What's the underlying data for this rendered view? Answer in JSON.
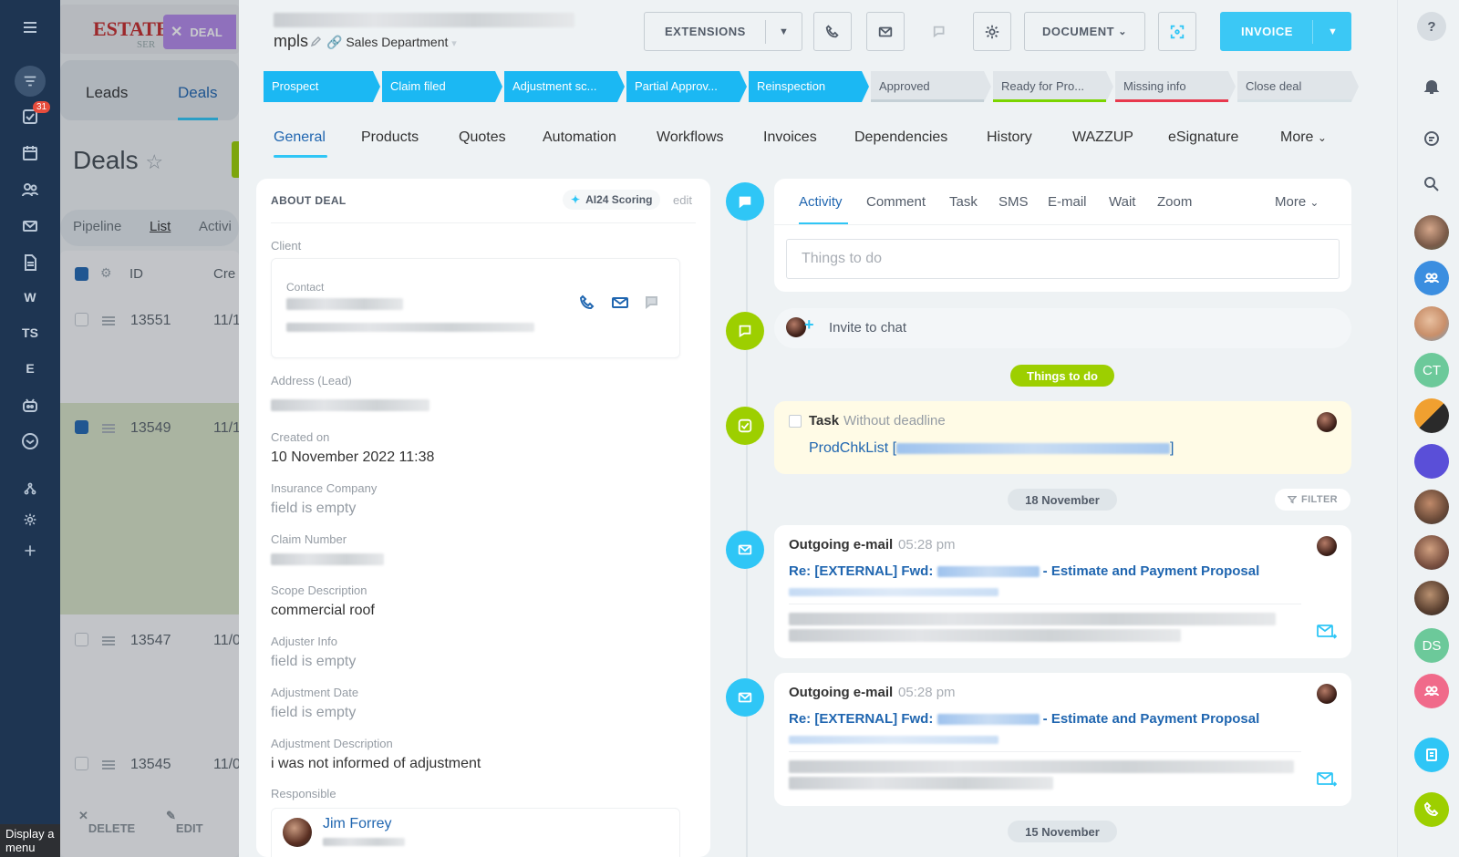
{
  "left_sidebar": {
    "badge": "31",
    "letters": [
      "W",
      "TS",
      "E"
    ],
    "tooltip": "Display a menu"
  },
  "background_list": {
    "logo_text": "ESTATE",
    "logo_sub": "SER",
    "deal_tag": "DEAL",
    "tabs": [
      "Leads",
      "Deals"
    ],
    "title": "Deals",
    "views": [
      "Pipeline",
      "List",
      "Activi"
    ],
    "id_header": "ID",
    "created_header": "Cre",
    "rows": [
      {
        "id": "13551",
        "date": "11/1"
      },
      {
        "id": "13549",
        "date": "11/1"
      },
      {
        "id": "13547",
        "date": "11/0"
      },
      {
        "id": "13545",
        "date": "11/0"
      }
    ],
    "actions": [
      "DELETE",
      "EDIT"
    ]
  },
  "header": {
    "title": "mpls",
    "department": "Sales Department",
    "buttons": {
      "extensions": "EXTENSIONS",
      "document": "DOCUMENT",
      "invoice": "INVOICE"
    }
  },
  "stages": [
    {
      "label": "Prospect",
      "active": true
    },
    {
      "label": "Claim filed",
      "active": true
    },
    {
      "label": "Adjustment sc...",
      "active": true
    },
    {
      "label": "Partial Approv...",
      "active": true
    },
    {
      "label": "Reinspection",
      "active": true
    },
    {
      "label": "Approved",
      "active": false,
      "color": "#c5d0d6"
    },
    {
      "label": "Ready for Pro...",
      "active": false,
      "color": "#7bd500"
    },
    {
      "label": "Missing info",
      "active": false,
      "color": "#e8394d"
    },
    {
      "label": "Close deal",
      "active": false,
      "color": "#d8e2e6"
    }
  ],
  "tabs": [
    "General",
    "Products",
    "Quotes",
    "Automation",
    "Workflows",
    "Invoices",
    "Dependencies",
    "History",
    "WAZZUP",
    "eSignature",
    "More"
  ],
  "about": {
    "heading": "ABOUT DEAL",
    "ai_scoring": "AI24 Scoring",
    "edit": "edit",
    "client_label": "Client",
    "contact_label": "Contact",
    "fields": [
      {
        "label": "Address (Lead)",
        "value": ""
      },
      {
        "label": "Created on",
        "value": "10 November 2022 11:38"
      },
      {
        "label": "Insurance Company",
        "value": "field is empty"
      },
      {
        "label": "Claim Number",
        "value": ""
      },
      {
        "label": "Scope Description",
        "value": "commercial roof"
      },
      {
        "label": "Adjuster Info",
        "value": "field is empty"
      },
      {
        "label": "Adjustment Date",
        "value": "field is empty"
      },
      {
        "label": "Adjustment Description",
        "value": "i was not informed of adjustment"
      }
    ],
    "responsible_label": "Responsible",
    "responsible_name": "Jim Forrey"
  },
  "activity": {
    "tabs": [
      "Activity",
      "Comment",
      "Task",
      "SMS",
      "E-mail",
      "Wait",
      "Zoom",
      "More"
    ],
    "input_placeholder": "Things to do",
    "invite_chat": "Invite to chat",
    "things_to_do": "Things to do",
    "task_title": "Task",
    "task_sub": "Without deadline",
    "task_link": "ProdChkList [",
    "task_link_end": "]",
    "date1": "18 November",
    "filter": "FILTER",
    "date2": "15 November",
    "emails": [
      {
        "title": "Outgoing e-mail",
        "time": "05:28 pm",
        "subject_prefix": "Re: [EXTERNAL] Fwd:",
        "subject_suffix": "- Estimate and Payment Proposal"
      },
      {
        "title": "Outgoing e-mail",
        "time": "05:28 pm",
        "subject_prefix": "Re: [EXTERNAL] Fwd:",
        "subject_suffix": "- Estimate and Payment Proposal"
      }
    ]
  },
  "right_bar": {
    "initials": [
      "CT",
      "DS"
    ]
  },
  "colors": {
    "accent": "#2fc6f6",
    "stage_active": "#1bb8f3",
    "green": "#9dcf00",
    "link": "#2066b0",
    "sidebar": "#1e3552"
  }
}
